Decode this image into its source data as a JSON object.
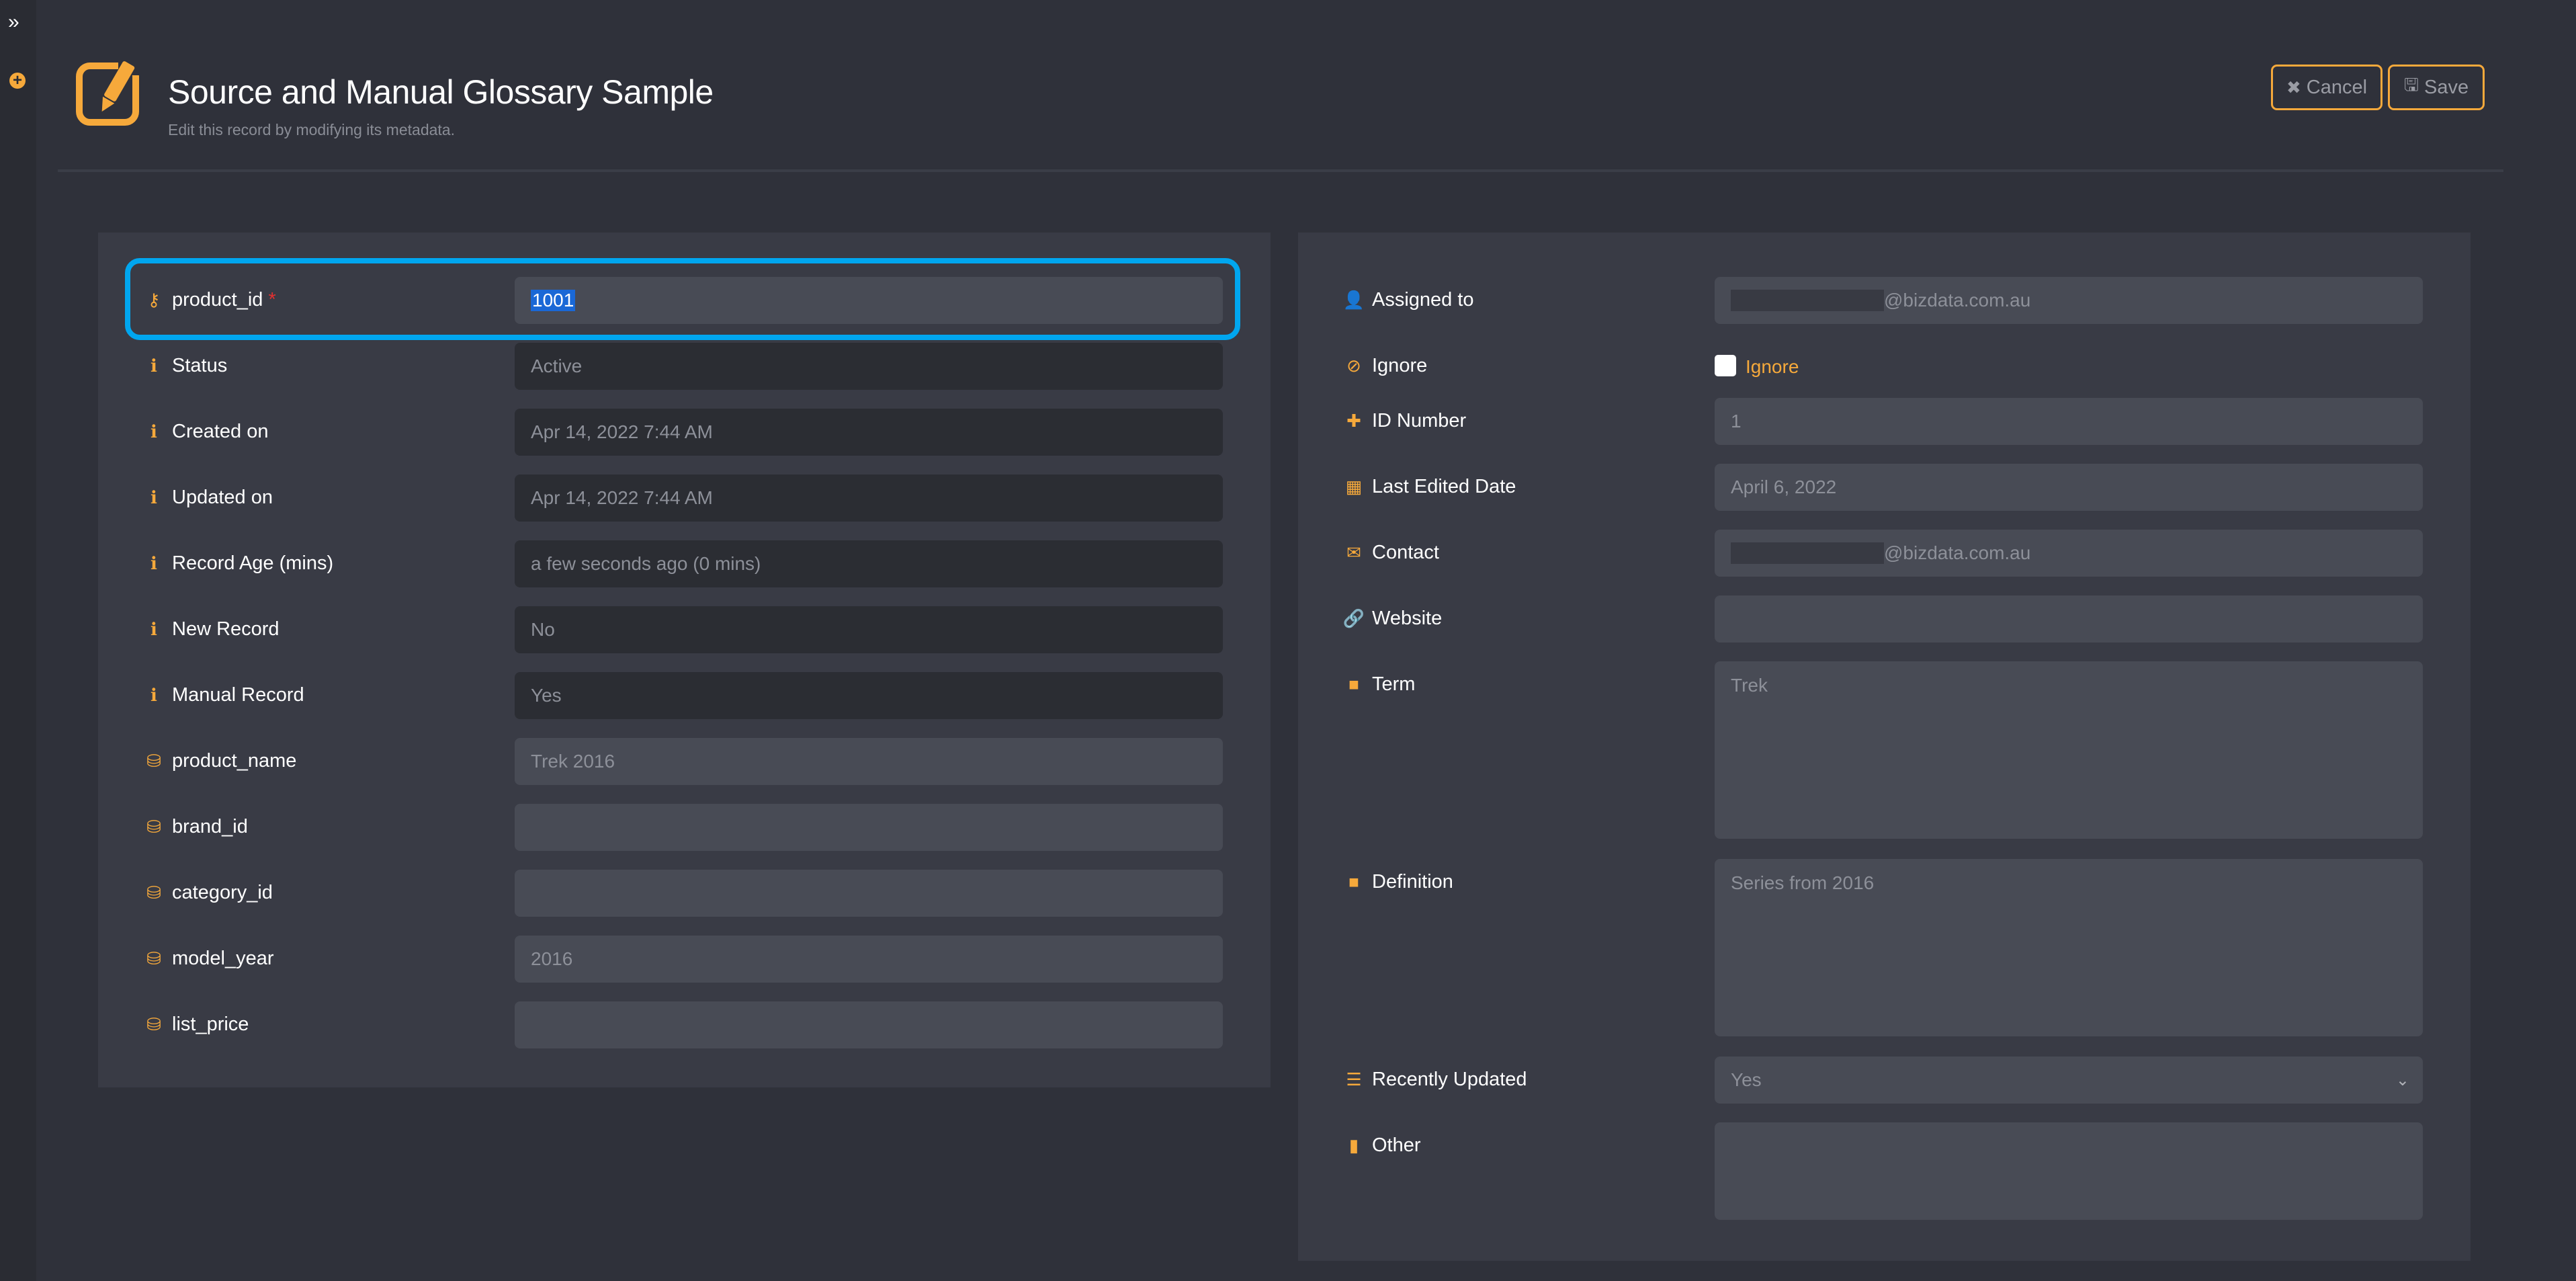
{
  "sidebar": {
    "expand_icon": "double-chevron-right-icon",
    "add_icon": "plus-circle-icon"
  },
  "header": {
    "icon": "edit-square-icon",
    "title": "Source and Manual Glossary Sample",
    "subtitle": "Edit this record by modifying its metadata.",
    "cancel_label": "Cancel",
    "cancel_icon": "times-icon",
    "save_label": "Save",
    "save_icon": "floppy-disk-icon"
  },
  "colors": {
    "accent": "#f6a93b",
    "focus": "#00a6ef",
    "background": "#2f313a",
    "panel": "#393b45",
    "required": "#e23030"
  },
  "left_panel": {
    "fields": [
      {
        "label": "product_id",
        "icon": "key-icon",
        "value": "1001",
        "required": true,
        "focused": true,
        "readonly": false
      },
      {
        "label": "Status",
        "icon": "info-circle-icon",
        "value": "Active",
        "readonly": true
      },
      {
        "label": "Created on",
        "icon": "info-circle-icon",
        "value": "Apr 14, 2022 7:44 AM",
        "readonly": true
      },
      {
        "label": "Updated on",
        "icon": "info-circle-icon",
        "value": "Apr 14, 2022 7:44 AM",
        "readonly": true
      },
      {
        "label": "Record Age (mins)",
        "icon": "info-circle-icon",
        "value": "a few seconds ago (0 mins)",
        "readonly": true
      },
      {
        "label": "New Record",
        "icon": "info-circle-icon",
        "value": "No",
        "readonly": true
      },
      {
        "label": "Manual Record",
        "icon": "info-circle-icon",
        "value": "Yes",
        "readonly": true
      },
      {
        "label": "product_name",
        "icon": "database-icon",
        "value": "Trek 2016",
        "readonly": false
      },
      {
        "label": "brand_id",
        "icon": "database-icon",
        "value": "",
        "readonly": false
      },
      {
        "label": "category_id",
        "icon": "database-icon",
        "value": "",
        "readonly": false
      },
      {
        "label": "model_year",
        "icon": "database-icon",
        "value": "2016",
        "readonly": false
      },
      {
        "label": "list_price",
        "icon": "database-icon",
        "value": "",
        "readonly": false
      }
    ]
  },
  "right_panel": {
    "assigned_to": {
      "label": "Assigned to",
      "icon": "user-icon",
      "value_suffix": "@bizdata.com.au"
    },
    "ignore": {
      "label": "Ignore",
      "icon": "eye-slash-icon",
      "checkbox_label": "Ignore",
      "checked": false
    },
    "id_number": {
      "label": "ID Number",
      "icon": "plus-icon",
      "value": "1"
    },
    "last_edited_date": {
      "label": "Last Edited Date",
      "icon": "calendar-icon",
      "value": "April 6, 2022"
    },
    "contact": {
      "label": "Contact",
      "icon": "envelope-icon",
      "value_suffix": "@bizdata.com.au"
    },
    "website": {
      "label": "Website",
      "icon": "link-icon",
      "value": ""
    },
    "term": {
      "label": "Term",
      "icon": "sticky-note-icon",
      "value": "Trek"
    },
    "definition": {
      "label": "Definition",
      "icon": "sticky-note-icon",
      "value": "Series from 2016"
    },
    "recently_updated": {
      "label": "Recently Updated",
      "icon": "list-icon",
      "value": "Yes"
    },
    "other": {
      "label": "Other",
      "icon": "file-icon",
      "value": ""
    }
  }
}
